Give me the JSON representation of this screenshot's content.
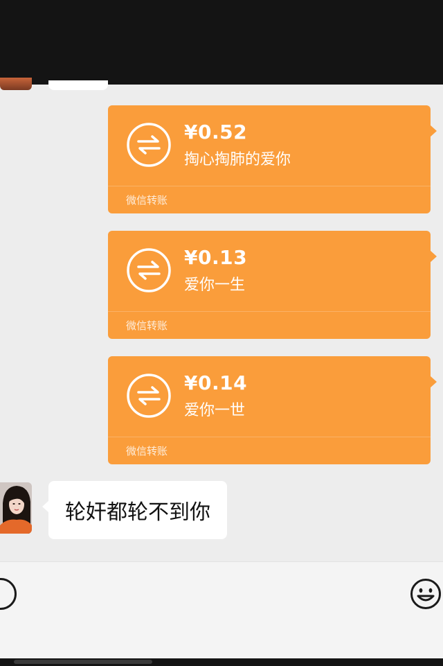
{
  "chat": {
    "transfers": [
      {
        "amount": "¥0.52",
        "memo": "掏心掏肺的爱你",
        "footer": "微信转账"
      },
      {
        "amount": "¥0.13",
        "memo": "爱你一生",
        "footer": "微信转账"
      },
      {
        "amount": "¥0.14",
        "memo": "爱你一世",
        "footer": "微信转账"
      }
    ],
    "incoming_message": {
      "text": "轮奸都轮不到你"
    }
  },
  "icons": {
    "transfer": "transfer-arrows-icon",
    "voice": "voice-icon",
    "emoji": "emoji-icon"
  },
  "colors": {
    "transfer_card": "#fa9d3b",
    "chat_background": "#ededed",
    "text_bubble": "#ffffff",
    "top_bar": "#141414"
  }
}
